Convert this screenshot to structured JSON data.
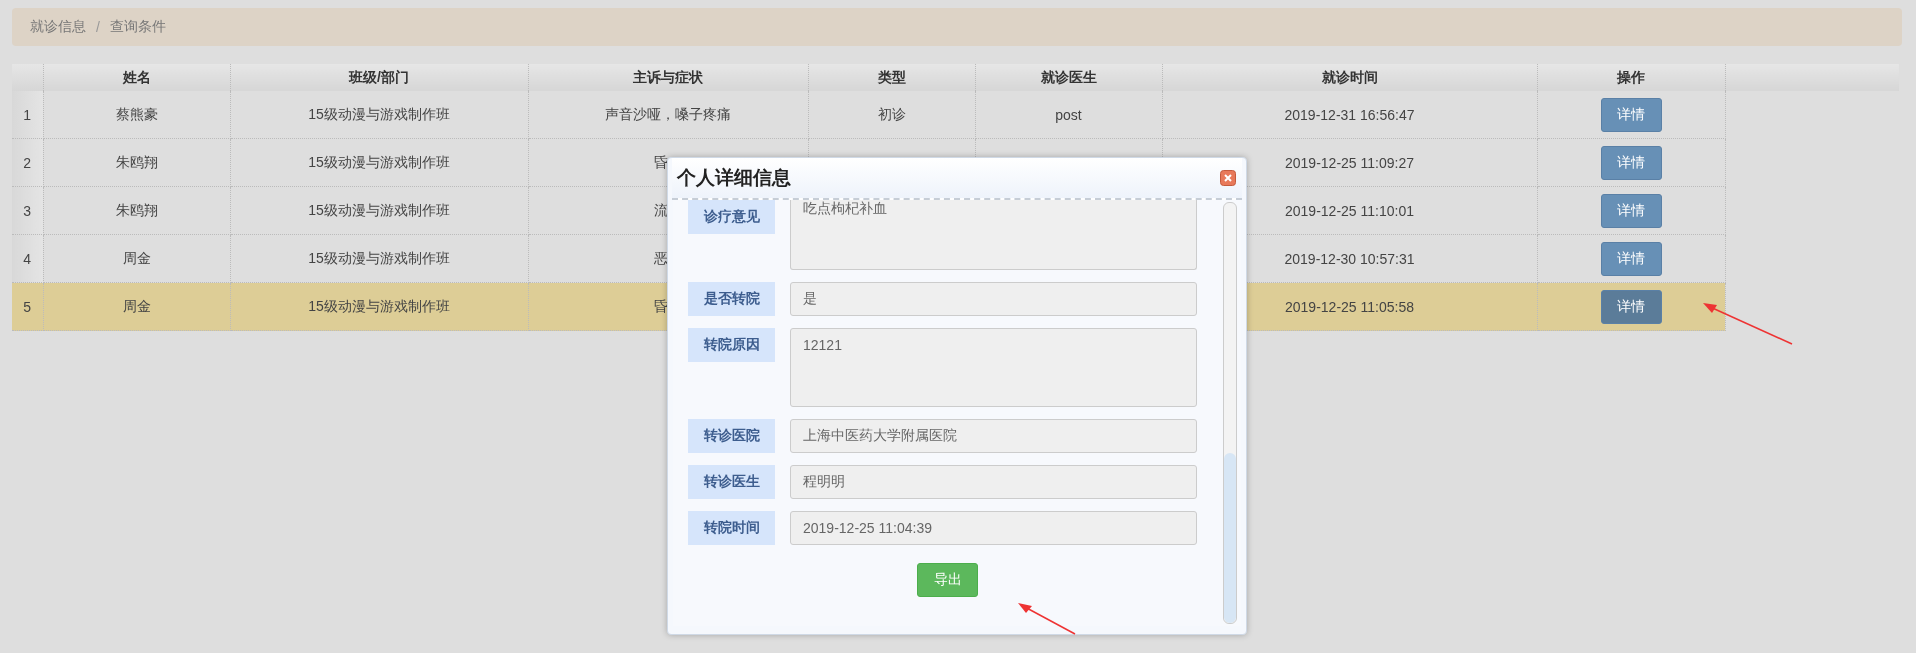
{
  "breadcrumb": {
    "items": [
      "就诊信息",
      "查询条件"
    ],
    "separator": "/"
  },
  "table": {
    "columns": [
      "姓名",
      "班级/部门",
      "主诉与症状",
      "类型",
      "就诊医生",
      "就诊时间",
      "操作"
    ],
    "rows": [
      {
        "index": "1",
        "name": "蔡熊豪",
        "class": "15级动漫与游戏制作班",
        "symptom": "声音沙哑，嗓子疼痛",
        "type": "初诊",
        "doctor": "post",
        "time": "2019-12-31 16:56:47",
        "action": "详情",
        "selected": false
      },
      {
        "index": "2",
        "name": "朱鸥翔",
        "class": "15级动漫与游戏制作班",
        "symptom": "昏",
        "time": "2019-12-25 11:09:27",
        "action": "详情",
        "selected": false
      },
      {
        "index": "3",
        "name": "朱鸥翔",
        "class": "15级动漫与游戏制作班",
        "symptom": "流",
        "time": "2019-12-25 11:10:01",
        "action": "详情",
        "selected": false
      },
      {
        "index": "4",
        "name": "周金",
        "class": "15级动漫与游戏制作班",
        "symptom": "恶",
        "time": "2019-12-30 10:57:31",
        "action": "详情",
        "selected": false
      },
      {
        "index": "5",
        "name": "周金",
        "class": "15级动漫与游戏制作班",
        "symptom": "昏",
        "time": "2019-12-25 11:05:58",
        "action": "详情",
        "selected": true
      }
    ]
  },
  "dialog": {
    "title": "个人详细信息",
    "fields": [
      {
        "label": "诊疗意见",
        "value": "吃点枸杞补血",
        "kind": "textarea"
      },
      {
        "label": "是否转院",
        "value": "是",
        "kind": "input"
      },
      {
        "label": "转院原因",
        "value": "12121",
        "kind": "textarea"
      },
      {
        "label": "转诊医院",
        "value": "上海中医药大学附属医院",
        "kind": "input"
      },
      {
        "label": "转诊医生",
        "value": "程明明",
        "kind": "input"
      },
      {
        "label": "转院时间",
        "value": "2019-12-25 11:04:39",
        "kind": "input"
      }
    ],
    "button": "导出"
  }
}
